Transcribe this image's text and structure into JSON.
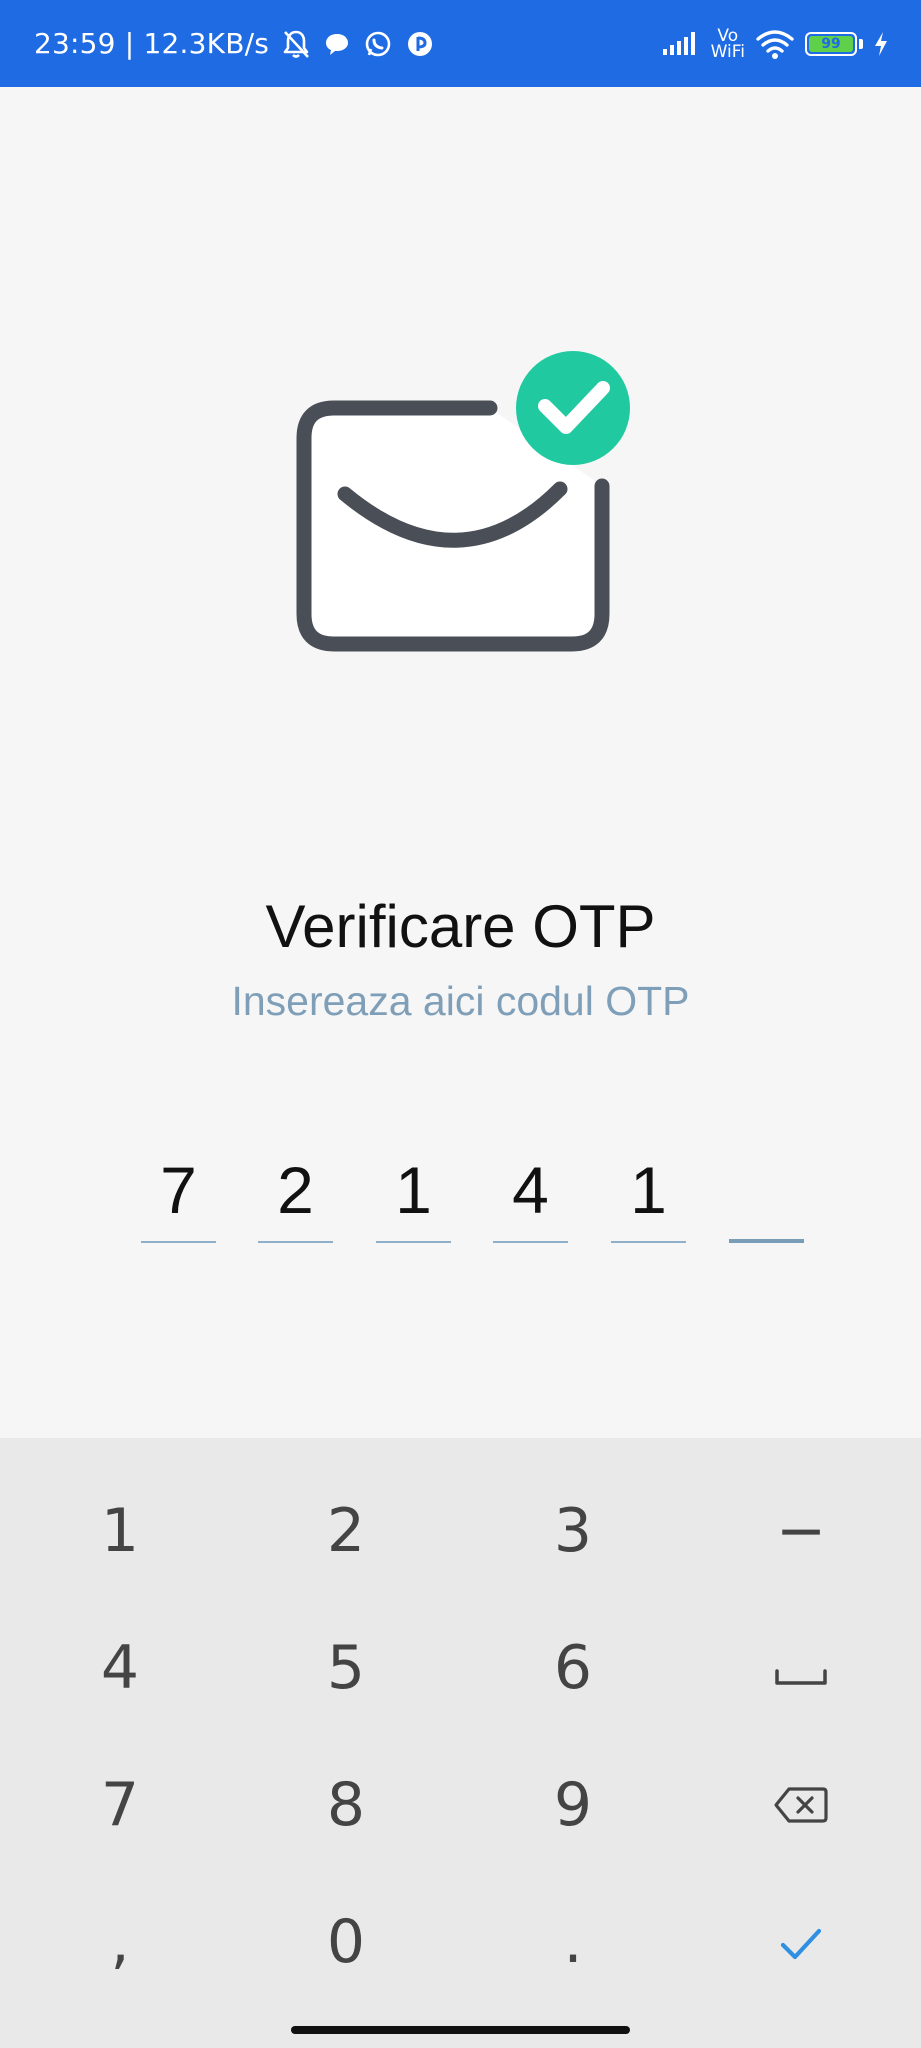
{
  "status_bar": {
    "time_speed": "23:59 | 12.3KB/s",
    "vowifi_top": "Vo",
    "vowifi_bottom": "WiFi",
    "battery_level": "99",
    "icons": [
      "bell-muted-icon",
      "chat-bubble-icon",
      "whatsapp-icon",
      "app-icon",
      "signal-icon",
      "wifi-icon",
      "battery-icon",
      "charging-icon"
    ],
    "background_color": "#1f6be3"
  },
  "illustration": {
    "icons": [
      "envelope-icon",
      "check-badge-icon"
    ],
    "badge_color": "#21c9a0",
    "envelope_color": "#4a4f57"
  },
  "main": {
    "title": "Verificare OTP",
    "subtitle": "Insereaza aici codul OTP",
    "subtitle_color": "#7f9fb8"
  },
  "otp": {
    "digits": [
      "7",
      "2",
      "1",
      "4",
      "1",
      ""
    ],
    "active_index": 5
  },
  "keyboard": {
    "rows": [
      [
        "1",
        "2",
        "3",
        "−"
      ],
      [
        "4",
        "5",
        "6",
        "space-icon"
      ],
      [
        "7",
        "8",
        "9",
        "backspace-icon"
      ],
      [
        ",",
        "0",
        ".",
        "confirm-check-icon"
      ]
    ],
    "keys": {
      "k1": "1",
      "k2": "2",
      "k3": "3",
      "minus": "−",
      "k4": "4",
      "k5": "5",
      "k6": "6",
      "k7": "7",
      "k8": "8",
      "k9": "9",
      "comma": ",",
      "k0": "0",
      "period": "."
    },
    "confirm_color": "#2f8fe3",
    "background_color": "#e9e9e9"
  }
}
